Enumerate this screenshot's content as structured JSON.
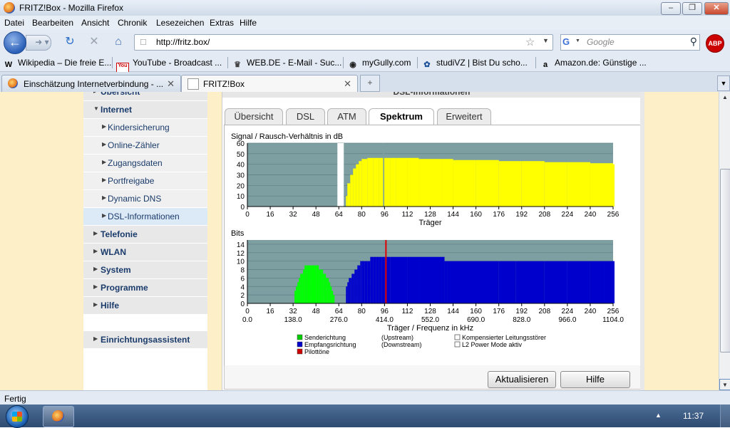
{
  "window": {
    "title": "FRITZ!Box - Mozilla Firefox",
    "controls": {
      "minimize": "–",
      "maximize": "❐",
      "close": "✕"
    }
  },
  "menu": [
    "Datei",
    "Bearbeiten",
    "Ansicht",
    "Chronik",
    "Lesezeichen",
    "Extras",
    "Hilfe"
  ],
  "navigation": {
    "url": "http://fritz.box/",
    "search_placeholder": "Google",
    "adblock_label": "ABP"
  },
  "bookmarks": [
    {
      "label": "Wikipedia – Die freie E...",
      "icon": "wikipedia-icon",
      "glyph": "W"
    },
    {
      "label": "YouTube - Broadcast ...",
      "icon": "youtube-icon",
      "glyph": "You"
    },
    {
      "label": "WEB.DE - E-Mail - Suc...",
      "icon": "webde-icon",
      "glyph": "♛"
    },
    {
      "label": "myGully.com",
      "icon": "mygully-icon",
      "glyph": "◉"
    },
    {
      "label": "studiVZ | Bist Du scho...",
      "icon": "studivz-icon",
      "glyph": "✿"
    },
    {
      "label": "Amazon.de: Günstige ...",
      "icon": "amazon-icon",
      "glyph": "a"
    }
  ],
  "tabs": [
    {
      "label": "Einschätzung Internetverbindung - ...",
      "active": false
    },
    {
      "label": "FRITZ!Box",
      "active": true
    }
  ],
  "sidebar": {
    "items": [
      {
        "label": "Übersicht",
        "level": 0
      },
      {
        "label": "Internet",
        "level": 0,
        "expanded": true
      },
      {
        "label": "Kindersicherung",
        "level": 1
      },
      {
        "label": "Online-Zähler",
        "level": 1
      },
      {
        "label": "Zugangsdaten",
        "level": 1
      },
      {
        "label": "Portfreigabe",
        "level": 1
      },
      {
        "label": "Dynamic DNS",
        "level": 1
      },
      {
        "label": "DSL-Informationen",
        "level": 1,
        "selected": true
      },
      {
        "label": "Telefonie",
        "level": 0
      },
      {
        "label": "WLAN",
        "level": 0
      },
      {
        "label": "System",
        "level": 0
      },
      {
        "label": "Programme",
        "level": 0
      },
      {
        "label": "Hilfe",
        "level": 0
      }
    ],
    "assistant": "Einrichtungsassistent"
  },
  "panel": {
    "heading": "DSL-Informationen",
    "tabs": [
      "Übersicht",
      "DSL",
      "ATM",
      "Spektrum",
      "Erweitert"
    ],
    "active_tab": "Spektrum",
    "buttons": {
      "refresh": "Aktualisieren",
      "help": "Hilfe"
    }
  },
  "chart_data": [
    {
      "type": "bar",
      "title": "Signal / Rausch-Verhältnis in dB",
      "xlabel": "Träger",
      "x_ticks": [
        0,
        16,
        32,
        48,
        64,
        80,
        96,
        112,
        128,
        144,
        160,
        176,
        192,
        208,
        224,
        240,
        256
      ],
      "ylim": [
        0,
        60
      ],
      "y_ticks": [
        0,
        10,
        20,
        30,
        40,
        50,
        60
      ],
      "grid": true,
      "background": "#7d9fa2",
      "bar_color": "#ffff00",
      "markers": [
        {
          "x": 65,
          "color": "#ffffff"
        },
        {
          "x": 97,
          "color": "#7d9fa2"
        }
      ],
      "series": [
        {
          "x": [
            69,
            70,
            72,
            74,
            76,
            78,
            80,
            84,
            88,
            92,
            96,
            100,
            104,
            112,
            120,
            128,
            136,
            144,
            160,
            176,
            192,
            208,
            224,
            240,
            256
          ],
          "values": [
            10,
            22,
            30,
            36,
            40,
            43,
            45,
            46,
            46,
            46,
            46,
            46,
            46,
            46,
            45,
            45,
            45,
            44,
            44,
            43,
            43,
            42,
            42,
            41,
            40
          ]
        }
      ]
    },
    {
      "type": "bar",
      "title": "Bits",
      "xlabel": "Träger / Frequenz in kHz",
      "x_ticks": [
        0,
        16,
        32,
        48,
        64,
        80,
        96,
        112,
        128,
        144,
        160,
        176,
        192,
        208,
        224,
        240,
        256
      ],
      "freq_ticks": [
        "0.0",
        "138.0",
        "276.0",
        "414.0",
        "552.0",
        "690.0",
        "828.0",
        "966.0",
        "1104.0"
      ],
      "ylim": [
        0,
        15
      ],
      "y_ticks": [
        0,
        2,
        4,
        6,
        8,
        10,
        12,
        14
      ],
      "grid": true,
      "background": "#7d9fa2",
      "series": [
        {
          "x": [
            33,
            34,
            35,
            36,
            37,
            38,
            39,
            40,
            41,
            42,
            44,
            48,
            50,
            52,
            53,
            54,
            55,
            56,
            57,
            58,
            59,
            60
          ],
          "values": [
            3,
            4,
            5,
            6,
            7,
            7,
            8,
            9,
            9,
            9,
            9,
            9,
            8,
            8,
            7,
            7,
            6,
            6,
            5,
            4,
            3,
            2
          ],
          "color": "#00ff00"
        },
        {
          "x": [
            69,
            70,
            71,
            72,
            73,
            74,
            75,
            76,
            77,
            78,
            79,
            80,
            82,
            84,
            86,
            88,
            90,
            92,
            94,
            96,
            100,
            112,
            120,
            128,
            130,
            138,
            140,
            176,
            188,
            208,
            224,
            240,
            250,
            253,
            256
          ],
          "values": [
            4,
            5,
            6,
            6,
            7,
            7,
            8,
            8,
            9,
            9,
            10,
            10,
            10,
            10,
            11,
            11,
            11,
            11,
            11,
            11,
            11,
            11,
            11,
            11,
            11,
            10,
            10,
            10,
            10,
            10,
            10,
            10,
            10,
            10,
            10
          ],
          "color": "#0000cc"
        }
      ],
      "pilot": {
        "x": 97,
        "color": "#e00000"
      },
      "legend": {
        "rows": [
          {
            "color": "#00cc00",
            "label": "Senderichtung",
            "note": "(Upstream)"
          },
          {
            "color": "#0000cc",
            "label": "Empfangsrichtung",
            "note": "(Downstream)"
          },
          {
            "color": "#cc0000",
            "label": "Pilottöne",
            "note": ""
          }
        ],
        "extra": [
          {
            "color": "#ffffff",
            "label": "Kompensierter Leitungsstörer"
          },
          {
            "color": "#ffffff",
            "label": "L2 Power Mode aktiv"
          }
        ]
      }
    }
  ],
  "status": {
    "text": "Fertig"
  },
  "taskbar": {
    "clock": "11:37",
    "tray_arrow": "▲"
  }
}
